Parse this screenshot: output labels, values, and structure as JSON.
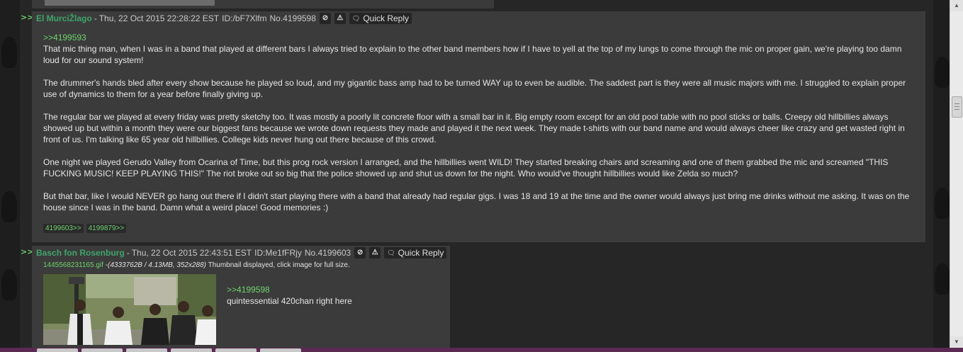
{
  "posts": [
    {
      "name": "El MurciŽlago",
      "date": "Thu, 22 Oct 2015 22:28:22 EST",
      "id": "ID:/bF7Xlfm",
      "number": "No.4199598",
      "quick_reply": "Quick Reply",
      "quote": ">>4199593",
      "paragraphs": [
        "That mic thing man, when I was in a band that played at different bars I always tried to explain to the other band members how if I have to yell at the top of my lungs to come through the mic on proper gain, we're playing too damn loud for our sound system!",
        "The drummer's hands bled after every show because he played so loud, and my gigantic bass amp had to be turned WAY up to even be audible. The saddest part is they were all music majors with me. I struggled to explain proper use of dynamics to them for a year before finally giving up.",
        "The regular bar we played at every friday was pretty sketchy too. It was mostly a poorly lit concrete floor with a small bar in it. Big empty room except for an old pool table with no pool sticks or balls. Creepy old hillbillies always showed up but within a month they were our biggest fans because we wrote down requests they made and played it the next week. They made t-shirts with our band name and would always cheer like crazy and get wasted right in front of us. I'm talking like 65 year old hillbillies. College kids never hung out there because of this crowd.",
        "One night we played Gerudo Valley from Ocarina of Time, but this prog rock version I arranged, and the hillbillies went WILD! They started breaking chairs and screaming and one of them grabbed the mic and screamed \"THIS FUCKING MUSIC! KEEP PLAYING THIS!\" The riot broke out so big that the police showed up and shut us down for the night. Who would've thought hillbillies would like Zelda so much?",
        "But that bar, like I would NEVER go hang out there if I didn't start playing there with a band that already had regular gigs. I was 18 and 19 at the time and the owner would always just bring me drinks without me asking. It was on the house since I was in the band. Damn what a weird place! Good memories :)"
      ],
      "backlinks": [
        "4199603>>",
        "4199879>>"
      ]
    },
    {
      "name": "Basch fon Rosenburg",
      "date": "Thu, 22 Oct 2015 22:43:51 EST",
      "id": "ID:Me1fFRjy",
      "number": "No.4199603",
      "quick_reply": "Quick Reply",
      "file_name": "1445568231165.gif",
      "file_meta": " -(4333762B / 4.13MB, 352x288)",
      "file_note": " Thumbnail displayed, click image for full size.",
      "quote": ">>4199598",
      "text": "quintessential 420chan right here"
    }
  ],
  "ui": {
    "post_arrow": ">>",
    "dash": "-",
    "hide_glyph": "⊘",
    "report_glyph": "⚠",
    "reply_icon_glyph": "🗨",
    "scroll_up_glyph": "▲",
    "scroll_down_glyph": "▼"
  },
  "colors": {
    "background": "#262626",
    "post_bg": "#3b3b3b",
    "name": "#3fa46b",
    "quote": "#6fd36f",
    "text": "#e6e6e6"
  }
}
